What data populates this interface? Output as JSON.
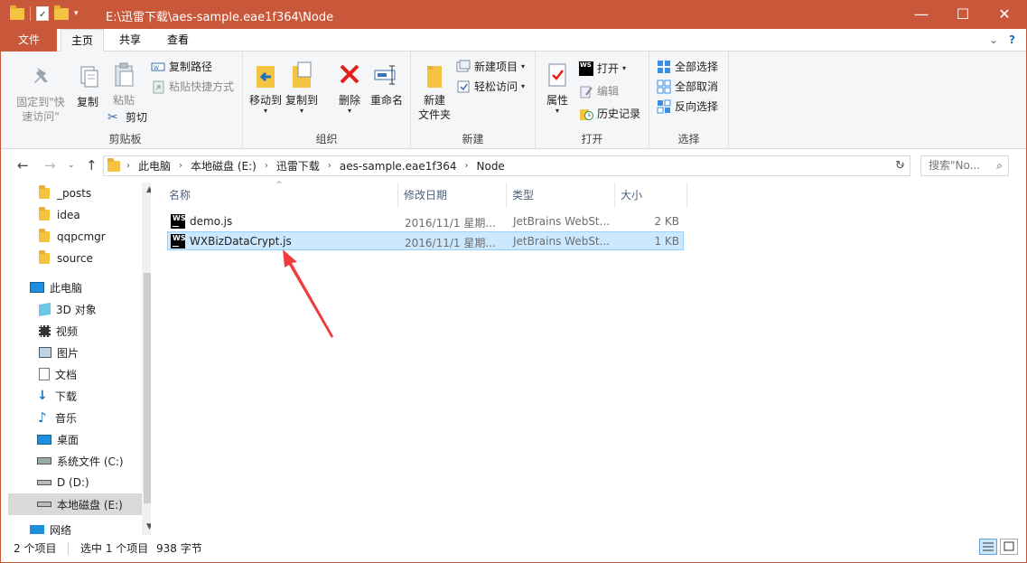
{
  "window": {
    "title": "E:\\迅雷下载\\aes-sample.eae1f364\\Node",
    "minimize": "—",
    "maximize": "☐",
    "close": "✕"
  },
  "tabs": [
    {
      "label": "文件"
    },
    {
      "label": "主页"
    },
    {
      "label": "共享"
    },
    {
      "label": "查看"
    }
  ],
  "ribbon": {
    "clipboard": {
      "label": "剪贴板",
      "pin_quick_access": "固定到\"快\n速访问\"",
      "copy": "复制",
      "paste": "粘贴",
      "copy_path": "复制路径",
      "paste_shortcut": "粘贴快捷方式",
      "cut": "剪切"
    },
    "organize": {
      "label": "组织",
      "move_to": "移动到",
      "copy_to": "复制到",
      "delete": "删除",
      "rename": "重命名"
    },
    "new": {
      "label": "新建",
      "new_folder": "新建\n文件夹",
      "new_item": "新建项目",
      "easy_access": "轻松访问"
    },
    "open": {
      "label": "打开",
      "properties": "属性",
      "open": "打开",
      "edit": "编辑",
      "history": "历史记录"
    },
    "select": {
      "label": "选择",
      "select_all": "全部选择",
      "select_none": "全部取消",
      "invert": "反向选择"
    }
  },
  "address": {
    "crumbs": [
      "此电脑",
      "本地磁盘 (E:)",
      "迅雷下载",
      "aes-sample.eae1f364",
      "Node"
    ],
    "search_placeholder": "搜索\"No..."
  },
  "nav": {
    "items": [
      {
        "label": "_posts"
      },
      {
        "label": "idea"
      },
      {
        "label": "qqpcmgr"
      },
      {
        "label": "source"
      },
      {
        "label": "此电脑"
      },
      {
        "label": "3D 对象"
      },
      {
        "label": "视频"
      },
      {
        "label": "图片"
      },
      {
        "label": "文档"
      },
      {
        "label": "下载"
      },
      {
        "label": "音乐"
      },
      {
        "label": "桌面"
      },
      {
        "label": "系统文件 (C:)"
      },
      {
        "label": "D (D:)"
      },
      {
        "label": "本地磁盘 (E:)"
      },
      {
        "label": "网络"
      }
    ]
  },
  "columns": {
    "name": "名称",
    "date": "修改日期",
    "type": "类型",
    "size": "大小"
  },
  "files": [
    {
      "name": "demo.js",
      "date": "2016/11/1 星期...",
      "type": "JetBrains WebSt...",
      "size": "2 KB",
      "icon": "webstorm-icon"
    },
    {
      "name": "WXBizDataCrypt.js",
      "date": "2016/11/1 星期...",
      "type": "JetBrains WebSt...",
      "size": "1 KB",
      "icon": "webstorm-icon"
    }
  ],
  "status": {
    "count": "2 个项目",
    "selected": "选中 1 个项目",
    "size": "938 字节"
  },
  "colors": {
    "titlebar": "#c9573a",
    "selection": "#cce8ff",
    "annotation_arrow": "#f03c3c"
  }
}
